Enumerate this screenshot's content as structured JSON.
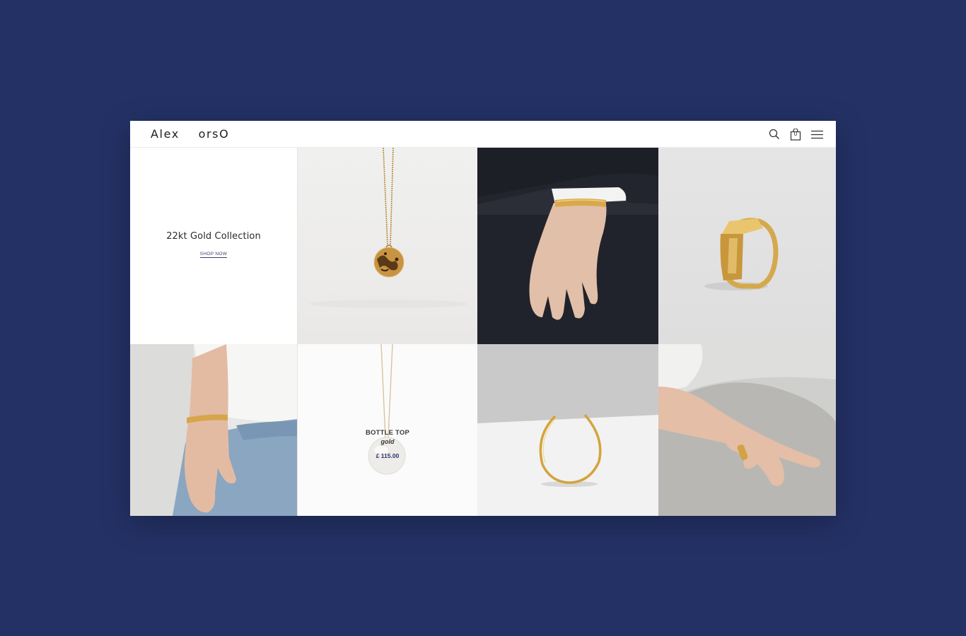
{
  "header": {
    "logo": "Alex    orsO",
    "icons": [
      "search-icon",
      "bag-icon",
      "menu-icon"
    ],
    "cart_count": "0"
  },
  "promo": {
    "title": "22kt Gold Collection",
    "link": "SHOP NOW"
  },
  "product_overlay": {
    "name": "BOTTLE TOP",
    "variant": "gold",
    "price": "£ 115.00"
  },
  "colors": {
    "page_background": "#233165",
    "gold": "#d4a94c",
    "link_navy": "#3a3f6a"
  }
}
